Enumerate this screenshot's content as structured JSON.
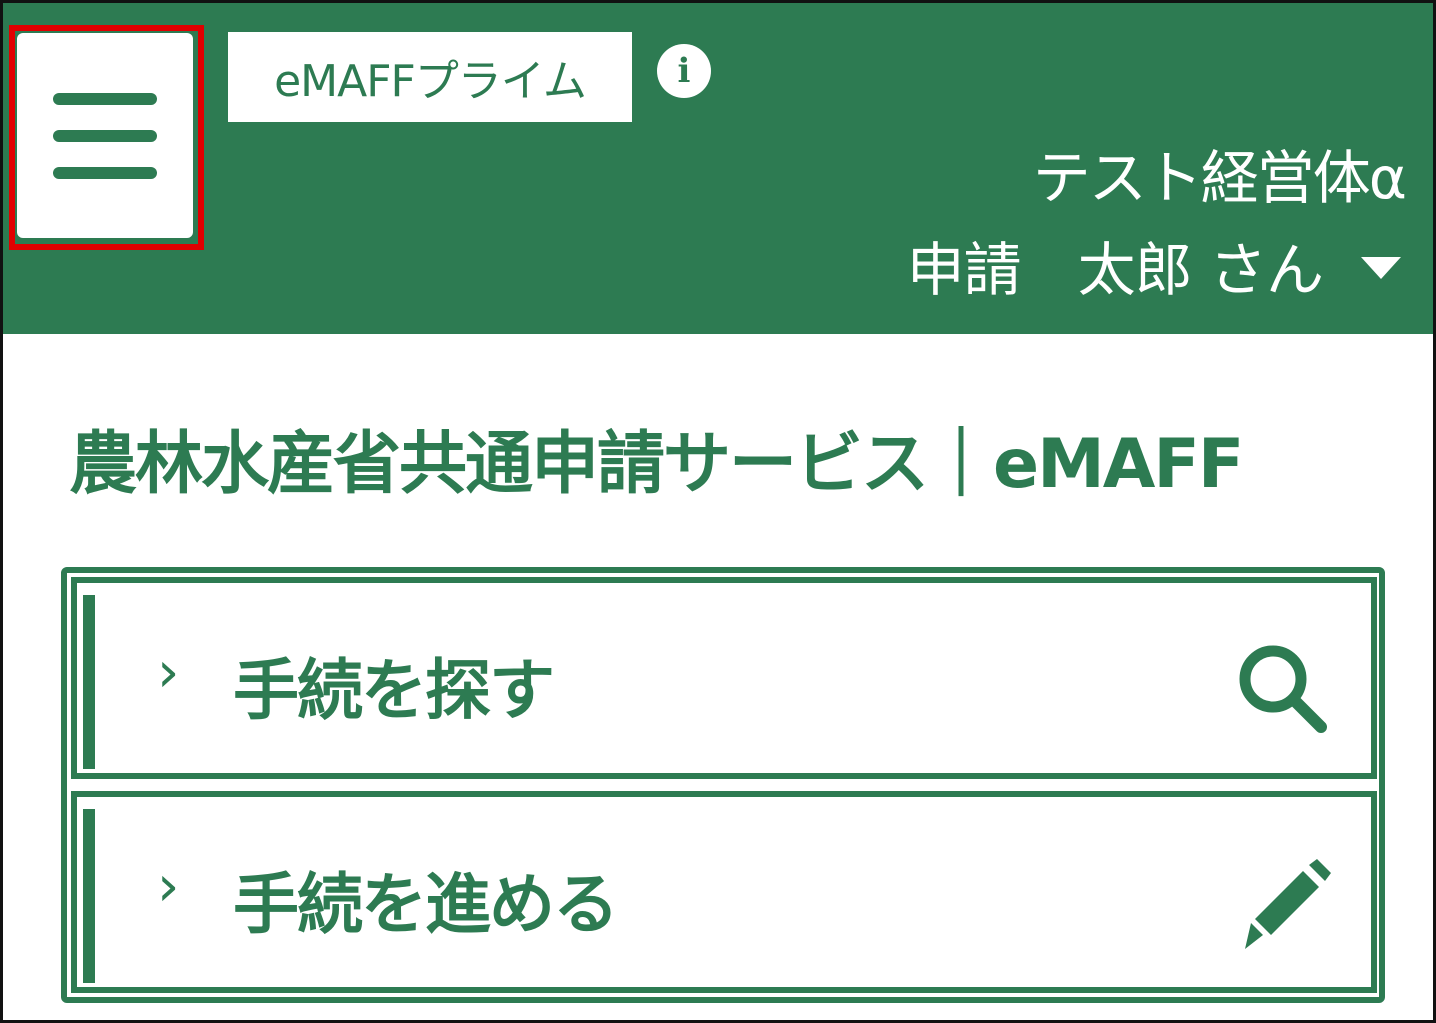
{
  "colors": {
    "brand": "#2d7b52",
    "highlight": "#e00000",
    "background": "#ffffff"
  },
  "header": {
    "menu_icon": "hamburger-menu-icon",
    "app_badge": "eMAFFプライム",
    "info_icon": "info-icon",
    "info_glyph": "i",
    "organization": "テスト経営体α",
    "user_name": "申請　太郎 さん",
    "user_menu_icon": "caret-down-icon"
  },
  "main": {
    "service_title": "農林水産省共通申請サービス｜eMAFF",
    "actions": [
      {
        "chevron": "›",
        "label": "手続を探す",
        "icon": "search-icon"
      },
      {
        "chevron": "›",
        "label": "手続を進める",
        "icon": "pencil-icon"
      }
    ]
  }
}
